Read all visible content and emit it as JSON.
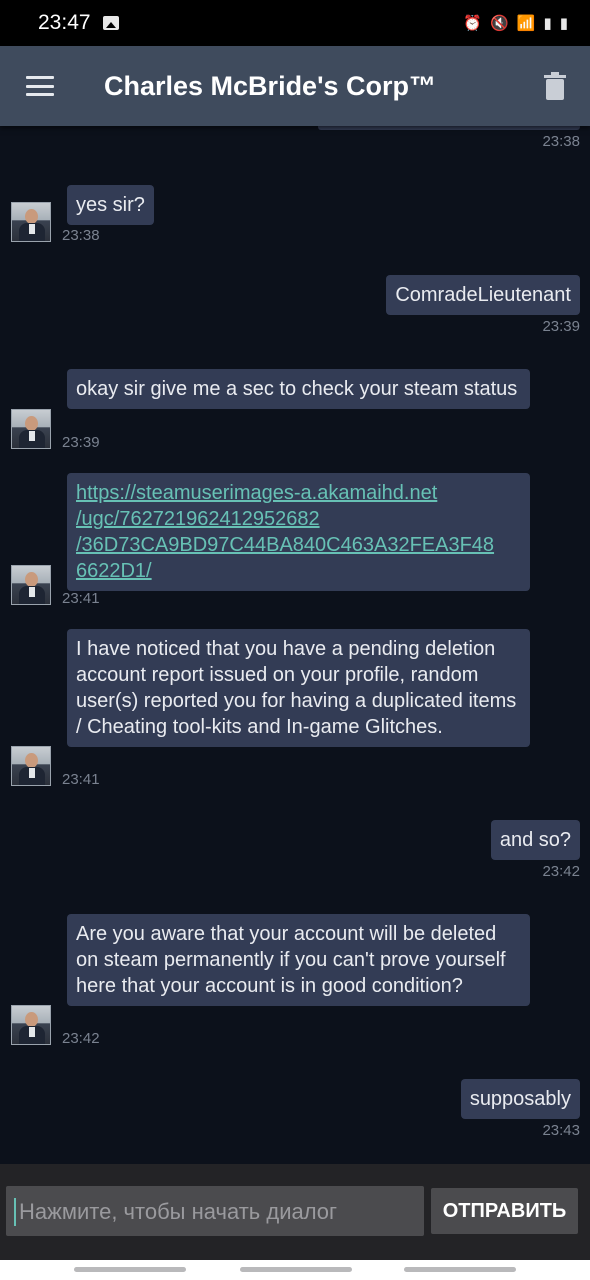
{
  "status_bar": {
    "time": "23:47"
  },
  "app_bar": {
    "title": "Charles McBride's Corp™"
  },
  "messages": [
    {
      "direction": "out",
      "text": "",
      "time": "23:38"
    },
    {
      "direction": "in",
      "text": "yes sir?",
      "time": "23:38"
    },
    {
      "direction": "out",
      "text": "ComradeLieutenant",
      "time": "23:39"
    },
    {
      "direction": "in",
      "text": "okay sir give me a sec to check your steam status",
      "time": "23:39"
    },
    {
      "direction": "in",
      "link_lines": [
        "https://steamuserimages-a.akamaihd.net",
        "/ugc/762721962412952682",
        "/36D73CA9BD97C44BA840C463A32FEA3F48",
        "6622D1/"
      ],
      "time": "23:41"
    },
    {
      "direction": "in",
      "text": "I have noticed that you have a pending deletion account report issued on your profile, random user(s) reported you for having a duplicated items / Cheating tool-kits and In-game Glitches.",
      "time": "23:41"
    },
    {
      "direction": "out",
      "text": "and so?",
      "time": "23:42"
    },
    {
      "direction": "in",
      "text": "Are you aware that your account will be deleted on steam permanently if you can't prove yourself here that your account is in good condition?",
      "time": "23:42"
    },
    {
      "direction": "out",
      "text": "supposably",
      "time": "23:43"
    }
  ],
  "composer": {
    "placeholder": "Нажмите, чтобы начать диалог",
    "send_label": "ОТПРАВИТЬ"
  }
}
